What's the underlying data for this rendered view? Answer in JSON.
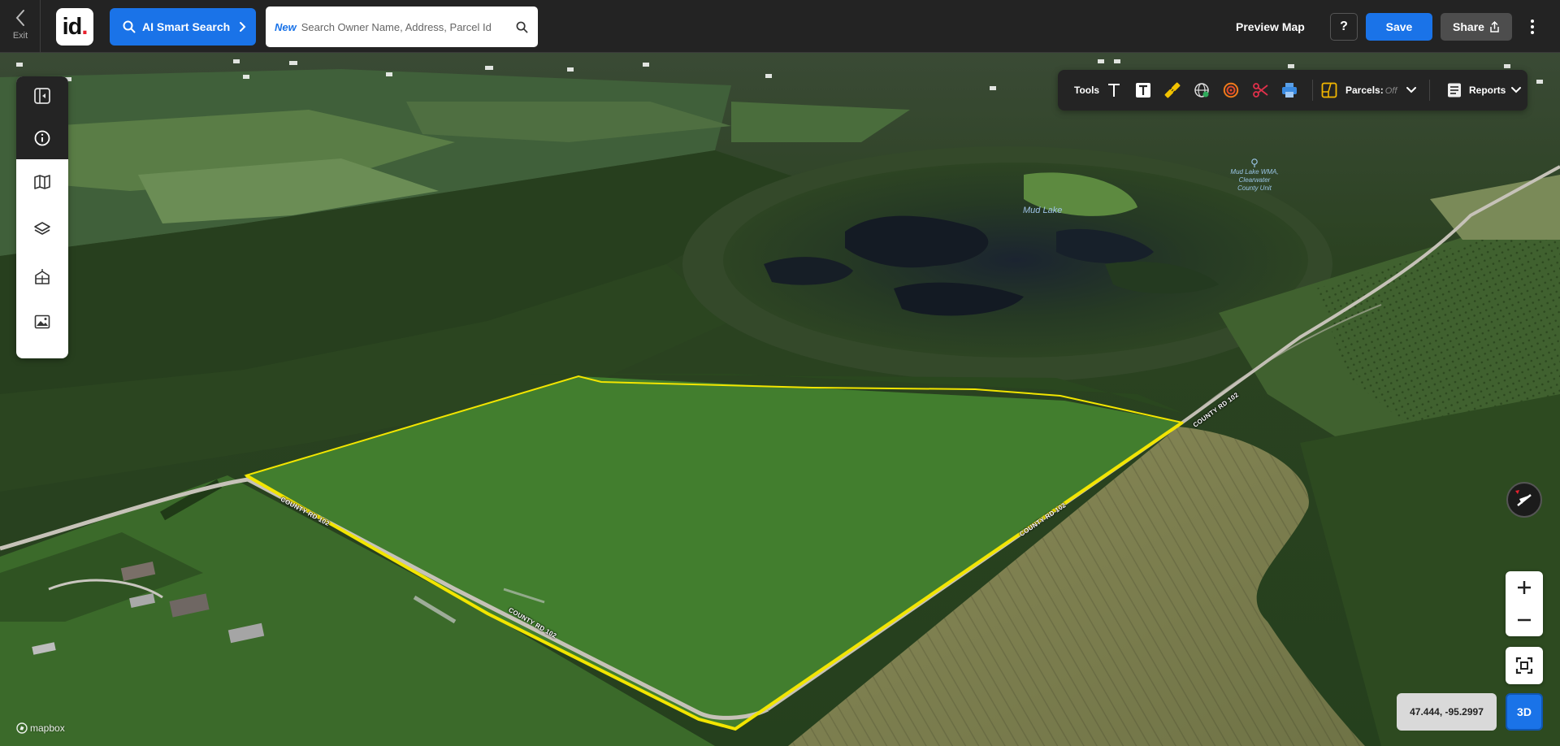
{
  "topbar": {
    "exit_label": "Exit",
    "logo_text": "id",
    "logo_dot": ".",
    "ai_search_label": "AI Smart Search",
    "search_badge": "New",
    "search_placeholder": "Search Owner Name, Address, Parcel Id",
    "preview_map_label": "Preview Map",
    "help_label": "?",
    "save_label": "Save",
    "share_label": "Share"
  },
  "sidebar": {
    "items": [
      {
        "name": "panel-toggle",
        "icon": "panel-toggle-icon"
      },
      {
        "name": "info",
        "icon": "info-icon"
      },
      {
        "name": "map",
        "icon": "map-icon"
      },
      {
        "name": "layers",
        "icon": "layers-icon"
      },
      {
        "name": "buildings",
        "icon": "buildings-icon"
      },
      {
        "name": "image",
        "icon": "image-icon"
      }
    ]
  },
  "toolbar": {
    "tools_label": "Tools",
    "tools": [
      "text-icon",
      "text-box-icon",
      "ruler-icon",
      "globe-measure-icon",
      "radius-icon",
      "scissors-icon",
      "print-icon"
    ],
    "parcels_label": "Parcels:",
    "parcels_state": "Off",
    "reports_label": "Reports"
  },
  "map": {
    "lake_label": "Mud Lake",
    "wma_label_line1": "Mud Lake WMA,",
    "wma_label_line2": "Clearwater",
    "wma_label_line3": "County Unit",
    "road_labels": [
      "COUNTY RD 102",
      "COUNTY RD 102",
      "COUNTY RD 102",
      "COUNTY RD 102"
    ],
    "coords": "47.444, -95.2997",
    "btn_3d": "3D",
    "attribution": "mapbox"
  },
  "colors": {
    "accent": "#1a73e8",
    "topbar_bg": "#232323",
    "parcel_outline": "#f2e500",
    "logo_dot": "#e8212e"
  }
}
